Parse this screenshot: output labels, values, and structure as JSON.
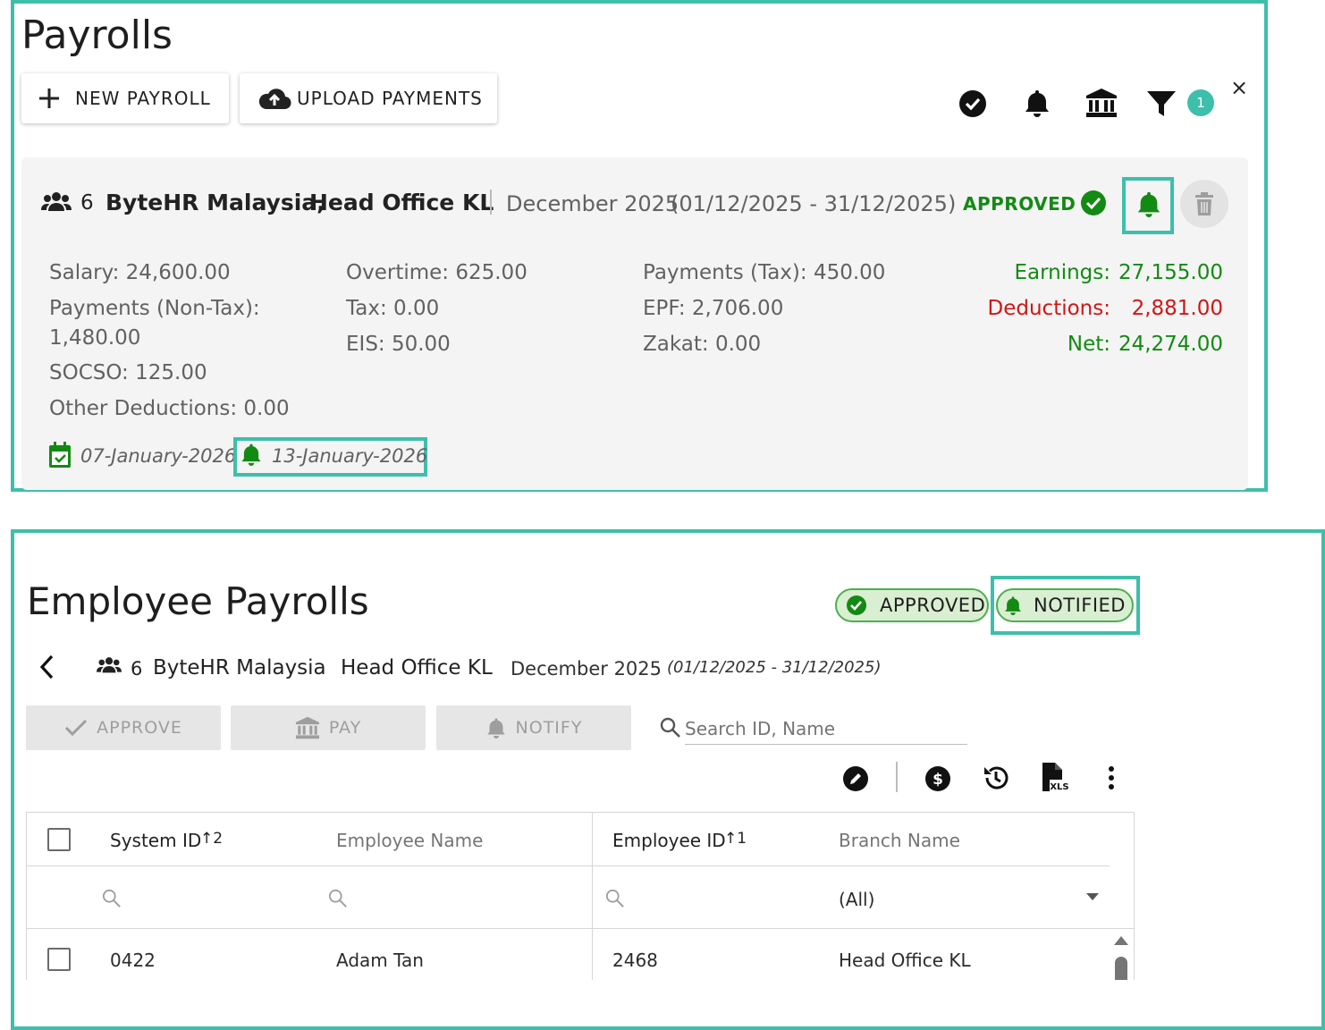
{
  "payrolls": {
    "title": "Payrolls",
    "new_payroll_label": "NEW PAYROLL",
    "upload_payments_label": "UPLOAD PAYMENTS",
    "filter_badge_count": "1",
    "close_label": "×",
    "header_icons": [
      "check-circle-icon",
      "bell-icon",
      "bank-icon",
      "filter-icon"
    ],
    "card": {
      "employee_count": "6",
      "company": "ByteHR Malaysia,",
      "branch": "Head Office KL",
      "period": "December 2025",
      "range": "(01/12/2025 - 31/12/2025)",
      "status": "APPROVED",
      "summary": {
        "salary": "Salary: 24,600.00",
        "payments_nontax_line1": "Payments (Non-Tax):",
        "payments_nontax_line2": "1,480.00",
        "socso": "SOCSO: 125.00",
        "other_deductions": "Other Deductions: 0.00",
        "overtime": "Overtime: 625.00",
        "tax": "Tax: 0.00",
        "eis": "EIS: 50.00",
        "payments_tax": "Payments (Tax): 450.00",
        "epf": "EPF: 2,706.00",
        "zakat": "Zakat: 0.00"
      },
      "totals": {
        "earnings_label": "Earnings:",
        "earnings_value": "27,155.00",
        "deductions_label": "Deductions:",
        "deductions_value": "2,881.00",
        "net_label": "Net:",
        "net_value": "24,274.00"
      },
      "approved_date": "07-January-2026",
      "notified_date": "13-January-2026"
    }
  },
  "employee_payrolls": {
    "title": "Employee Payrolls",
    "status_approved": "APPROVED",
    "status_notified": "NOTIFIED",
    "back_label": "<",
    "employee_count": "6",
    "company": "ByteHR Malaysia",
    "branch": "Head Office KL",
    "period": "December 2025",
    "range": "(01/12/2025 - 31/12/2025)",
    "actions": {
      "approve": "APPROVE",
      "pay": "PAY",
      "notify": "NOTIFY"
    },
    "search_placeholder": "Search ID, Name",
    "toolbar_icons": [
      "edit-icon",
      "dollar-icon",
      "history-icon",
      "xls-file-icon",
      "more-vert-icon"
    ],
    "table": {
      "columns": [
        "System ID",
        "Employee Name",
        "Employee ID",
        "Branch Name"
      ],
      "sort_system_id": "↑2",
      "sort_employee_id": "↑1",
      "branch_filter": "(All)",
      "rows": [
        {
          "system_id": "0422",
          "employee_name": "Adam Tan",
          "employee_id": "2468",
          "branch": "Head Office KL"
        }
      ]
    }
  },
  "colors": {
    "accent_teal": "#3dbfab",
    "success_green": "#138a13",
    "deduction_red": "#d01616",
    "pill_bg": "#d9efd1"
  }
}
